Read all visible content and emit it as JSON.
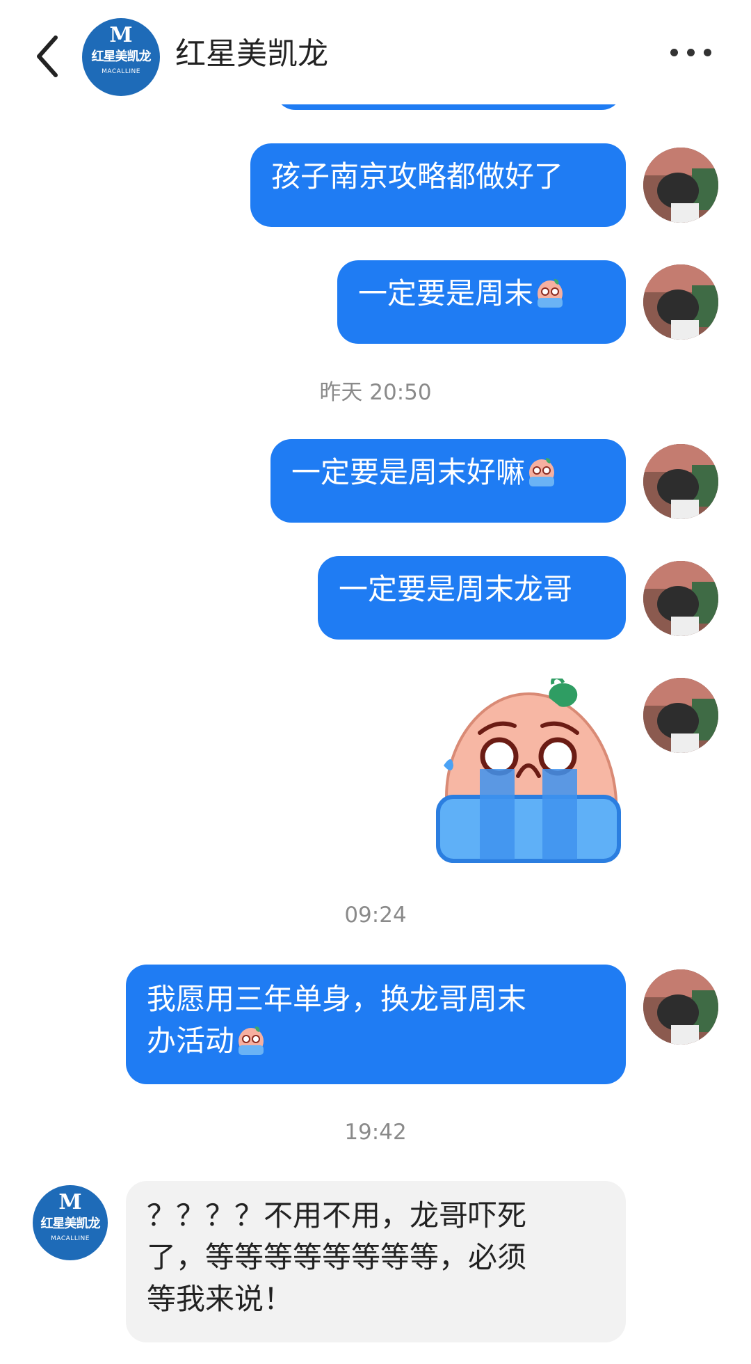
{
  "header": {
    "title": "红星美凯龙",
    "brand_avatar": {
      "letter": "M",
      "cn": "红星美凯龙",
      "en": "MACALLINE"
    }
  },
  "messages": [
    {
      "text": "孩子南京攻略都做好了"
    },
    {
      "text": "一定要是周末",
      "emoji": "crying-emoji"
    },
    {
      "time": "昨天 20:50"
    },
    {
      "text": "一定要是周末好嘛",
      "emoji": "crying-emoji"
    },
    {
      "text": "一定要是周末龙哥"
    },
    {
      "sticker": "crying-peach-sticker"
    },
    {
      "time": "09:24"
    },
    {
      "line1": "我愿用三年单身，换龙哥周末",
      "line2": "办活动",
      "emoji": "crying-emoji"
    },
    {
      "time": "19:42"
    },
    {
      "line1": "？？？？不用不用，龙哥吓死",
      "line2": "了，等等等等等等等等，必须",
      "line3": "等我来说！"
    }
  ],
  "colors": {
    "sent_bubble": "#1f7cf3",
    "received_bubble": "#f2f2f2",
    "timestamp": "#8a8a8a",
    "brand_blue": "#1e6bb8"
  }
}
